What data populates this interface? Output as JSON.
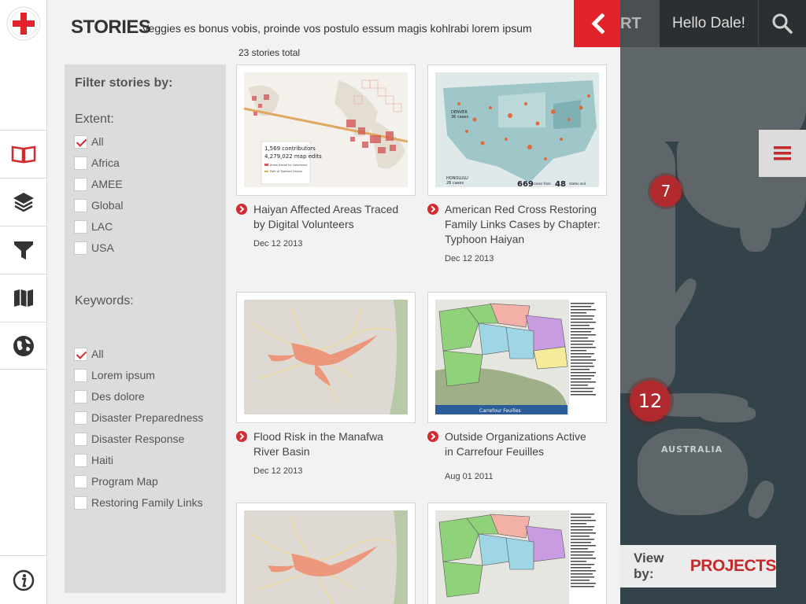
{
  "header": {
    "story_tab_text": "RT",
    "greeting": "Hello Dale!",
    "search_icon": "search-icon"
  },
  "panel": {
    "title": "STORIES",
    "subtitle": "Veggies es bonus vobis, proinde vos postulo essum magis kohlrabi lorem ipsum",
    "total": "23 stories total"
  },
  "filter": {
    "heading": "Filter stories by:",
    "extent_label": "Extent:",
    "extent": [
      {
        "label": "All",
        "checked": true
      },
      {
        "label": "Africa",
        "checked": false
      },
      {
        "label": "AMEE",
        "checked": false
      },
      {
        "label": "Global",
        "checked": false
      },
      {
        "label": "LAC",
        "checked": false
      },
      {
        "label": "USA",
        "checked": false
      }
    ],
    "keywords_label": "Keywords:",
    "keywords": [
      {
        "label": "All",
        "checked": true
      },
      {
        "label": "Lorem ipsum",
        "checked": false
      },
      {
        "label": "Des dolore",
        "checked": false
      },
      {
        "label": "Disaster Preparedness",
        "checked": false
      },
      {
        "label": "Disaster Response",
        "checked": false
      },
      {
        "label": "Haiti",
        "checked": false
      },
      {
        "label": "Program Map",
        "checked": false
      },
      {
        "label": "Restoring Family Links",
        "checked": false
      }
    ]
  },
  "stories": [
    {
      "title": "Haiyan Affected Areas Traced by Digital Volunteers",
      "date": "Dec 12 2013",
      "thumb_text": [
        "1,569 contributors",
        "4,279,022 map edits",
        "Areas traced by volunteers",
        "Path of Typhoon Haiyan"
      ]
    },
    {
      "title": "American Red Cross Restoring Family Links Cases by Chapter: Typhoon Haiyan",
      "date": "Dec 12 2013",
      "thumb_text": [
        "DENVER",
        "36 cases",
        "HONOLULU",
        "26 cases",
        "669",
        "cases from",
        "48",
        "states and"
      ]
    },
    {
      "title": "Flood Risk in the Manafwa River Basin",
      "date": "Dec 12 2013",
      "thumb_text": []
    },
    {
      "title": "Outside Organizations Active in Carrefour Feuilles",
      "date": "Aug 01 2011",
      "thumb_text": [
        "Carrefour Feuilles"
      ]
    },
    {
      "title": "",
      "date": "",
      "thumb_text": []
    },
    {
      "title": "",
      "date": "",
      "thumb_text": []
    }
  ],
  "map": {
    "clusters": [
      {
        "count": "7"
      },
      {
        "count": "12"
      }
    ],
    "labels": [
      "AUSTRALIA"
    ]
  },
  "viewby": {
    "label": "View by:",
    "value": "PROJECTS"
  },
  "colors": {
    "accent": "#e3232a",
    "cluster": "#b02a2d",
    "panel_bg": "#f2f2f2",
    "filter_bg": "#dcdcdc"
  }
}
